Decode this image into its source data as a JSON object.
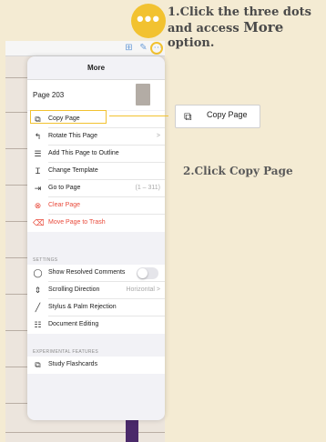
{
  "callout": {
    "step1_line1": "1.Click the three dots",
    "step1_line2_a": "and access ",
    "step1_line2_b": "More",
    "step1_line2_c": " option.",
    "step2": "2.Click Copy Page",
    "copy_box_label": "Copy Page",
    "dots_symbol": "•••",
    "accent_color": "#f2c230"
  },
  "panel": {
    "title": "More",
    "page_label": "Page 203",
    "items": [
      {
        "label": "Copy Page",
        "icon": "copy-icon",
        "glyph": "⧉"
      },
      {
        "label": "Rotate This Page",
        "icon": "rotate-icon",
        "glyph": "↰",
        "value": ">"
      },
      {
        "label": "Add This Page to Outline",
        "icon": "outline-icon",
        "glyph": "☰"
      },
      {
        "label": "Change Template",
        "icon": "template-icon",
        "glyph": "Ɪ"
      },
      {
        "label": "Go to Page",
        "icon": "goto-icon",
        "glyph": "⇥",
        "value": "(1 – 311)"
      },
      {
        "label": "Clear Page",
        "icon": "clear-icon",
        "glyph": "⊗"
      },
      {
        "label": "Move Page to Trash",
        "icon": "trash-icon",
        "glyph": "🗑"
      }
    ],
    "settings_header": "SETTINGS",
    "settings": [
      {
        "label": "Show Resolved Comments",
        "icon": "comment-icon",
        "glyph": "◯"
      },
      {
        "label": "Scrolling Direction",
        "icon": "scroll-direction-icon",
        "glyph": "⇕",
        "value": "Horizontal >"
      },
      {
        "label": "Stylus & Palm Rejection",
        "icon": "stylus-icon",
        "glyph": "╱"
      },
      {
        "label": "Document Editing",
        "icon": "editing-icon",
        "glyph": "☷"
      }
    ],
    "experimental_header": "EXPERIMENTAL FEATURES",
    "experimental": [
      {
        "label": "Study Flashcards",
        "icon": "flashcards-icon",
        "glyph": "⧉"
      }
    ],
    "toggle_show_resolved": false
  }
}
